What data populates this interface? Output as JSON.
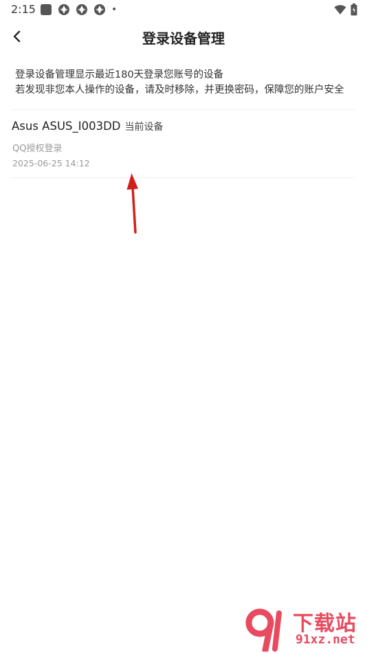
{
  "status_bar": {
    "time": "2:15",
    "dot": "•"
  },
  "header": {
    "title": "登录设备管理",
    "back_icon": "chevron-left-icon"
  },
  "intro": {
    "line1": "登录设备管理显示最近180天登录您账号的设备",
    "line2": "若发现非您本人操作的设备，请及时移除，并更换密码，保障您的账户安全"
  },
  "devices": [
    {
      "name": "Asus ASUS_I003DD",
      "current_label": "当前设备",
      "login_method": "QQ授权登录",
      "time": "2025-06-25 14:12"
    }
  ],
  "watermark": {
    "top": "下载站",
    "bottom": "91xz.net"
  },
  "colors": {
    "annotation_arrow": "#d0201c",
    "watermark": "#e84a5f"
  }
}
